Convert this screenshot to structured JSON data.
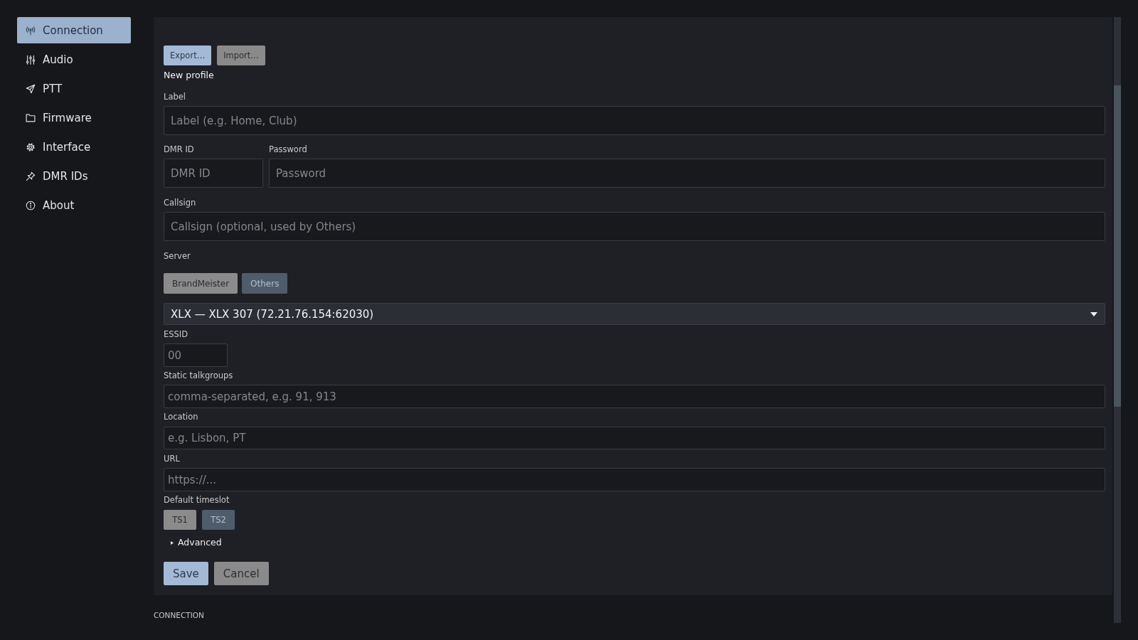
{
  "sidebar": {
    "items": [
      {
        "label": "Connection",
        "selected": true
      },
      {
        "label": "Audio",
        "selected": false
      },
      {
        "label": "PTT",
        "selected": false
      },
      {
        "label": "Firmware",
        "selected": false
      },
      {
        "label": "Interface",
        "selected": false
      },
      {
        "label": "DMR IDs",
        "selected": false
      },
      {
        "label": "About",
        "selected": false
      }
    ]
  },
  "profile_actions": [
    {
      "label": "Export…",
      "kind": "primary"
    },
    {
      "label": "Import…",
      "kind": "secondary"
    }
  ],
  "form": {
    "heading": "New profile",
    "label_field": {
      "label": "Label",
      "placeholder": "Label (e.g. Home, Club)"
    },
    "dmr_id_field": {
      "label": "DMR ID",
      "placeholder": "DMR ID"
    },
    "password_field": {
      "label": "Password",
      "placeholder": "Password"
    },
    "callsign_field": {
      "label": "Callsign",
      "placeholder": "Callsign (optional, used by Others)"
    },
    "server": {
      "label": "Server",
      "options": [
        {
          "label": "BrandMeister",
          "selected": false
        },
        {
          "label": "Others",
          "selected": true
        }
      ],
      "select_value": "XLX — XLX 307 (72.21.76.154:62030)"
    },
    "essid_field": {
      "label": "ESSID",
      "placeholder": "00"
    },
    "talkgroups_field": {
      "label": "Static talkgroups",
      "placeholder": "comma-separated, e.g. 91, 913"
    },
    "location_field": {
      "label": "Location",
      "placeholder": "e.g. Lisbon, PT"
    },
    "url_field": {
      "label": "URL",
      "placeholder": "https://..."
    },
    "timeslot": {
      "label": "Default timeslot",
      "options": [
        {
          "label": "TS1",
          "selected": false
        },
        {
          "label": "TS2",
          "selected": true
        }
      ]
    },
    "advanced": {
      "label": "Advanced",
      "expanded": false
    },
    "buttons": [
      {
        "label": "Save",
        "kind": "primary"
      },
      {
        "label": "Cancel",
        "kind": "secondary"
      }
    ]
  },
  "footer": {
    "section": "CONNECTION"
  }
}
